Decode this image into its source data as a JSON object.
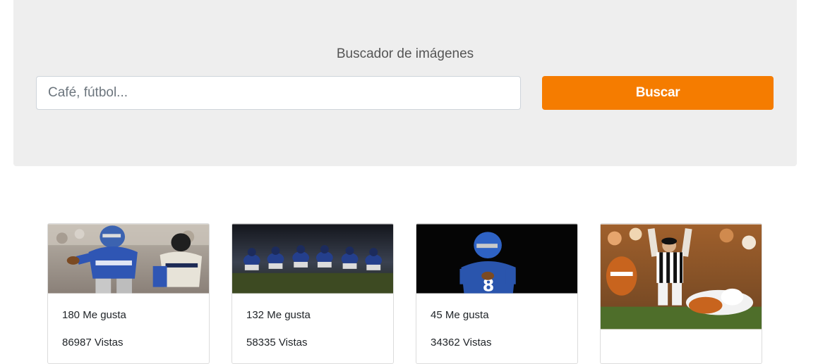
{
  "header": {
    "title": "Buscador de imágenes",
    "search_placeholder": "Café, fútbol...",
    "search_button_label": "Buscar",
    "accent_color": "#f57c00"
  },
  "results": [
    {
      "likes": "180 Me gusta",
      "views": "86987 Vistas"
    },
    {
      "likes": "132 Me gusta",
      "views": "58335 Vistas"
    },
    {
      "likes": "45 Me gusta",
      "views": "34362 Vistas"
    },
    {
      "likes": "",
      "views": ""
    }
  ]
}
